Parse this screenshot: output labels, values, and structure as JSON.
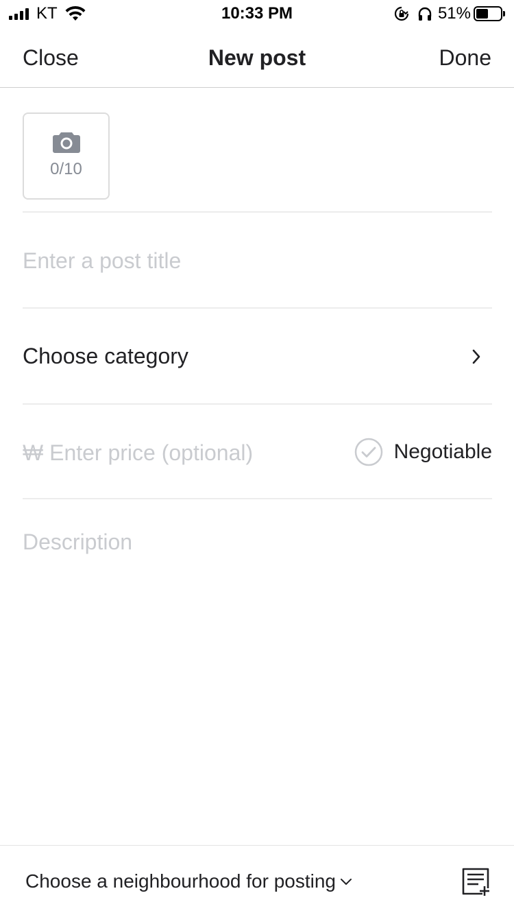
{
  "status_bar": {
    "carrier": "KT",
    "time": "10:33 PM",
    "battery_percent": "51%",
    "battery_level": 0.51
  },
  "nav": {
    "close_label": "Close",
    "title": "New post",
    "done_label": "Done"
  },
  "photos": {
    "count_label": "0/10",
    "icon": "camera-icon"
  },
  "form": {
    "title_placeholder": "Enter a post title",
    "title_value": "",
    "category_label": "Choose category",
    "price_placeholder": "₩ Enter price (optional)",
    "price_value": "",
    "negotiable_label": "Negotiable",
    "negotiable_checked": false,
    "description_placeholder": "Description",
    "description_value": ""
  },
  "bottom": {
    "neighbourhood_label": "Choose a neighbourhood for posting",
    "template_icon": "add-template-icon"
  },
  "colors": {
    "text": "#212124",
    "placeholder": "#c9cbcf",
    "icon_gray": "#868b94",
    "divider": "#ececec"
  }
}
